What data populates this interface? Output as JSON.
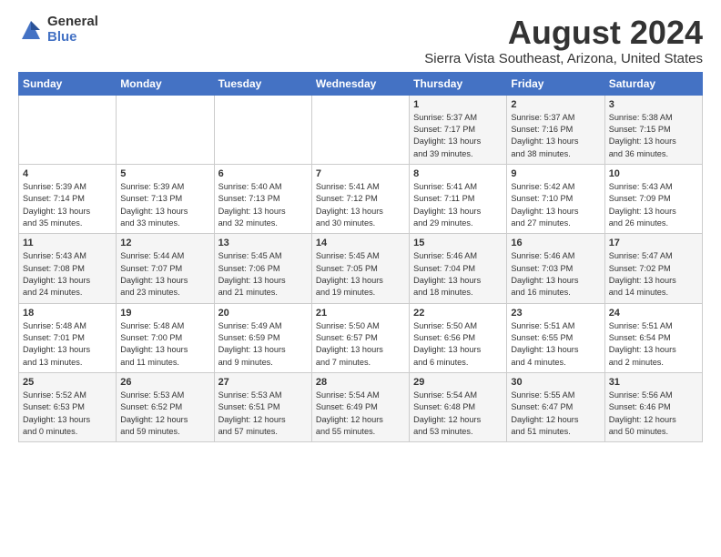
{
  "logo": {
    "general": "General",
    "blue": "Blue"
  },
  "title": "August 2024",
  "location": "Sierra Vista Southeast, Arizona, United States",
  "days_of_week": [
    "Sunday",
    "Monday",
    "Tuesday",
    "Wednesday",
    "Thursday",
    "Friday",
    "Saturday"
  ],
  "weeks": [
    [
      {
        "day": "",
        "info": ""
      },
      {
        "day": "",
        "info": ""
      },
      {
        "day": "",
        "info": ""
      },
      {
        "day": "",
        "info": ""
      },
      {
        "day": "1",
        "info": "Sunrise: 5:37 AM\nSunset: 7:17 PM\nDaylight: 13 hours\nand 39 minutes."
      },
      {
        "day": "2",
        "info": "Sunrise: 5:37 AM\nSunset: 7:16 PM\nDaylight: 13 hours\nand 38 minutes."
      },
      {
        "day": "3",
        "info": "Sunrise: 5:38 AM\nSunset: 7:15 PM\nDaylight: 13 hours\nand 36 minutes."
      }
    ],
    [
      {
        "day": "4",
        "info": "Sunrise: 5:39 AM\nSunset: 7:14 PM\nDaylight: 13 hours\nand 35 minutes."
      },
      {
        "day": "5",
        "info": "Sunrise: 5:39 AM\nSunset: 7:13 PM\nDaylight: 13 hours\nand 33 minutes."
      },
      {
        "day": "6",
        "info": "Sunrise: 5:40 AM\nSunset: 7:13 PM\nDaylight: 13 hours\nand 32 minutes."
      },
      {
        "day": "7",
        "info": "Sunrise: 5:41 AM\nSunset: 7:12 PM\nDaylight: 13 hours\nand 30 minutes."
      },
      {
        "day": "8",
        "info": "Sunrise: 5:41 AM\nSunset: 7:11 PM\nDaylight: 13 hours\nand 29 minutes."
      },
      {
        "day": "9",
        "info": "Sunrise: 5:42 AM\nSunset: 7:10 PM\nDaylight: 13 hours\nand 27 minutes."
      },
      {
        "day": "10",
        "info": "Sunrise: 5:43 AM\nSunset: 7:09 PM\nDaylight: 13 hours\nand 26 minutes."
      }
    ],
    [
      {
        "day": "11",
        "info": "Sunrise: 5:43 AM\nSunset: 7:08 PM\nDaylight: 13 hours\nand 24 minutes."
      },
      {
        "day": "12",
        "info": "Sunrise: 5:44 AM\nSunset: 7:07 PM\nDaylight: 13 hours\nand 23 minutes."
      },
      {
        "day": "13",
        "info": "Sunrise: 5:45 AM\nSunset: 7:06 PM\nDaylight: 13 hours\nand 21 minutes."
      },
      {
        "day": "14",
        "info": "Sunrise: 5:45 AM\nSunset: 7:05 PM\nDaylight: 13 hours\nand 19 minutes."
      },
      {
        "day": "15",
        "info": "Sunrise: 5:46 AM\nSunset: 7:04 PM\nDaylight: 13 hours\nand 18 minutes."
      },
      {
        "day": "16",
        "info": "Sunrise: 5:46 AM\nSunset: 7:03 PM\nDaylight: 13 hours\nand 16 minutes."
      },
      {
        "day": "17",
        "info": "Sunrise: 5:47 AM\nSunset: 7:02 PM\nDaylight: 13 hours\nand 14 minutes."
      }
    ],
    [
      {
        "day": "18",
        "info": "Sunrise: 5:48 AM\nSunset: 7:01 PM\nDaylight: 13 hours\nand 13 minutes."
      },
      {
        "day": "19",
        "info": "Sunrise: 5:48 AM\nSunset: 7:00 PM\nDaylight: 13 hours\nand 11 minutes."
      },
      {
        "day": "20",
        "info": "Sunrise: 5:49 AM\nSunset: 6:59 PM\nDaylight: 13 hours\nand 9 minutes."
      },
      {
        "day": "21",
        "info": "Sunrise: 5:50 AM\nSunset: 6:57 PM\nDaylight: 13 hours\nand 7 minutes."
      },
      {
        "day": "22",
        "info": "Sunrise: 5:50 AM\nSunset: 6:56 PM\nDaylight: 13 hours\nand 6 minutes."
      },
      {
        "day": "23",
        "info": "Sunrise: 5:51 AM\nSunset: 6:55 PM\nDaylight: 13 hours\nand 4 minutes."
      },
      {
        "day": "24",
        "info": "Sunrise: 5:51 AM\nSunset: 6:54 PM\nDaylight: 13 hours\nand 2 minutes."
      }
    ],
    [
      {
        "day": "25",
        "info": "Sunrise: 5:52 AM\nSunset: 6:53 PM\nDaylight: 13 hours\nand 0 minutes."
      },
      {
        "day": "26",
        "info": "Sunrise: 5:53 AM\nSunset: 6:52 PM\nDaylight: 12 hours\nand 59 minutes."
      },
      {
        "day": "27",
        "info": "Sunrise: 5:53 AM\nSunset: 6:51 PM\nDaylight: 12 hours\nand 57 minutes."
      },
      {
        "day": "28",
        "info": "Sunrise: 5:54 AM\nSunset: 6:49 PM\nDaylight: 12 hours\nand 55 minutes."
      },
      {
        "day": "29",
        "info": "Sunrise: 5:54 AM\nSunset: 6:48 PM\nDaylight: 12 hours\nand 53 minutes."
      },
      {
        "day": "30",
        "info": "Sunrise: 5:55 AM\nSunset: 6:47 PM\nDaylight: 12 hours\nand 51 minutes."
      },
      {
        "day": "31",
        "info": "Sunrise: 5:56 AM\nSunset: 6:46 PM\nDaylight: 12 hours\nand 50 minutes."
      }
    ]
  ]
}
